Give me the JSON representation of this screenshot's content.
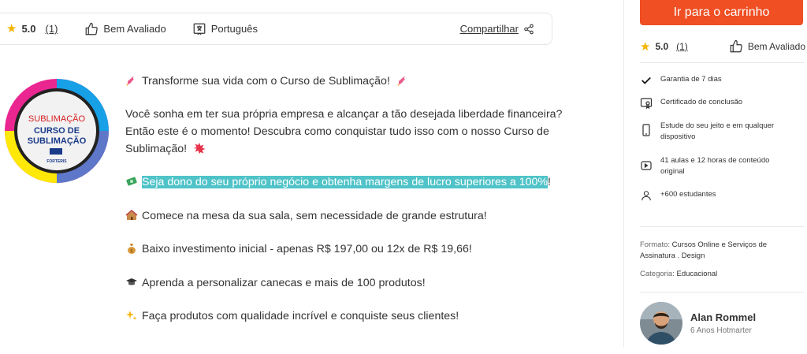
{
  "topbar": {
    "rating": "5.0",
    "rating_count": "(1)",
    "badge_label": "Bem Avaliado",
    "language": "Português",
    "share_label": "Compartilhar"
  },
  "thumbnail": {
    "line1": "SUBLIMAÇÃO",
    "line2": "CURSO DE",
    "line3": "SUBLIMAÇÃO",
    "brand": "FORTERIS"
  },
  "description": {
    "p1": "Transforme sua vida com o Curso de Sublimação!",
    "p2_l1": "Você sonha em ter sua própria empresa e alcançar a tão desejada liberdade financeira?",
    "p2_l2": "Então este é o momento! Descubra como conquistar tudo isso com o nosso Curso de",
    "p2_l3": "Sublimação!",
    "p3": "Seja dono do seu próprio negócio e obtenha margens de lucro superiores a 100%",
    "p3_end": "!",
    "p4": "Comece na mesa da sua sala, sem necessidade de grande estrutura!",
    "p5": "Baixo investimento inicial - apenas R$ 197,00 ou 12x de R$ 19,66!",
    "p6": "Aprenda a personalizar canecas e mais de 100 produtos!",
    "p7": "Faça produtos com qualidade incrível e conquiste seus clientes!"
  },
  "sidebar": {
    "cart_button": "Ir para o carrinho",
    "rating": "5.0",
    "rating_count": "(1)",
    "badge_label": "Bem Avaliado",
    "features": {
      "guarantee": "Garantia de 7 dias",
      "certificate": "Certificado de conclusão",
      "device_l1": "Estude do seu jeito e em qualquer",
      "device_l2": "dispositivo",
      "content_l1": "41 aulas e 12 horas de conteúdo",
      "content_l2": "original",
      "students": "+600 estudantes"
    },
    "format_label": "Formato:",
    "format_l1": "Cursos Online e Serviços de",
    "format_l2": "Assinatura . Design",
    "category_label": "Categoria:",
    "category_value": "Educacional",
    "instructor_name": "Alan Rommel",
    "instructor_sub": "6 Anos Hotmarter"
  },
  "colors": {
    "accent": "#f04e23",
    "highlight": "#4fc3c8",
    "star": "#f5b400"
  }
}
